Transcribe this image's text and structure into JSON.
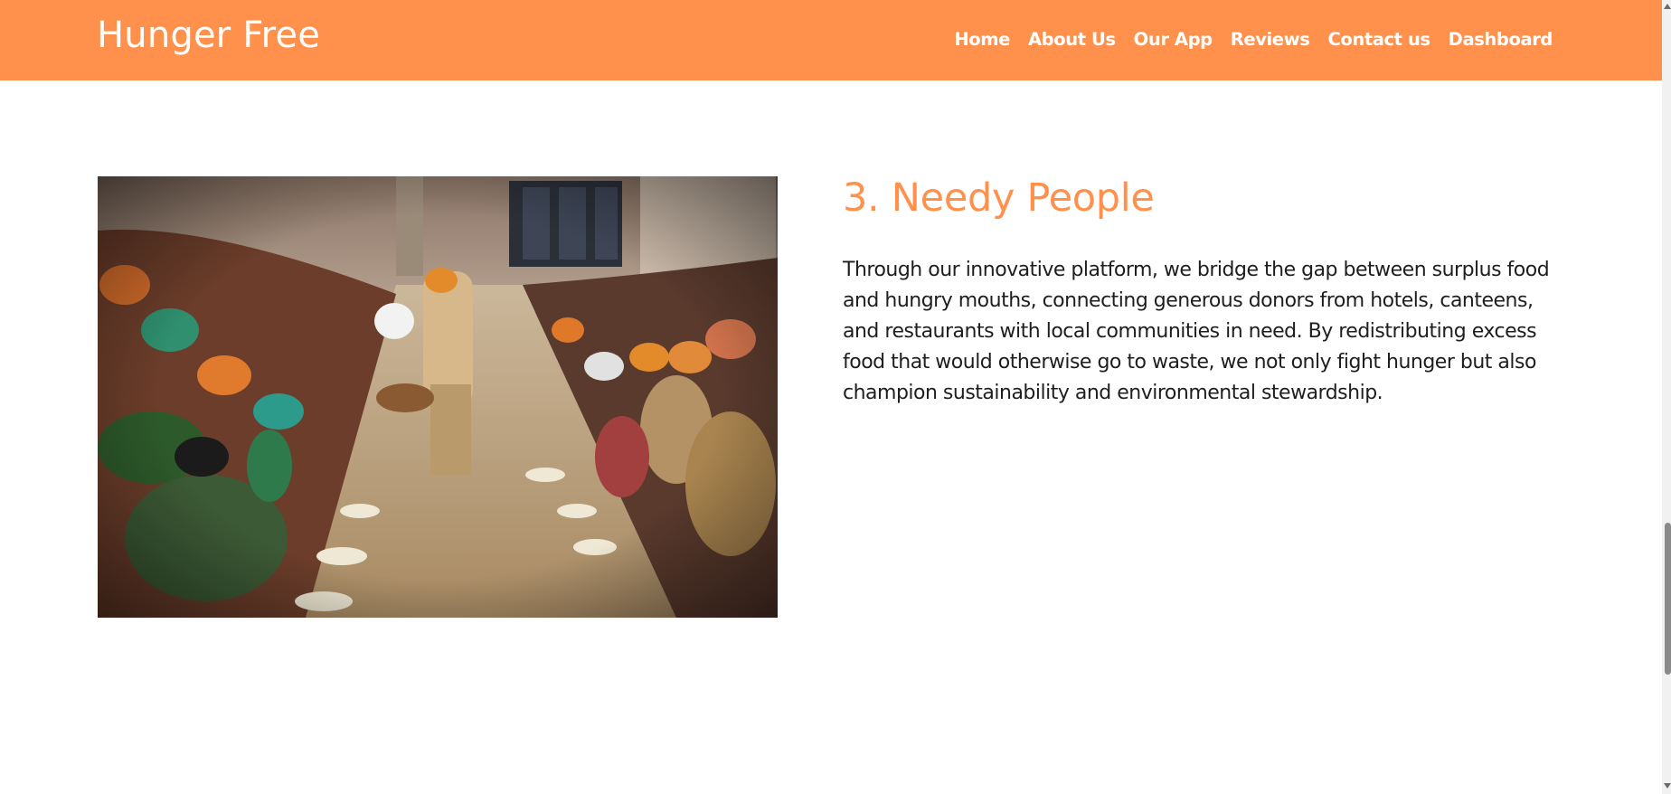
{
  "brand": {
    "name": "Hunger Free"
  },
  "nav": {
    "items": [
      {
        "label": "Home"
      },
      {
        "label": "About Us"
      },
      {
        "label": "Our App"
      },
      {
        "label": "Reviews"
      },
      {
        "label": "Contact us"
      },
      {
        "label": "Dashboard"
      }
    ]
  },
  "section": {
    "title": "3. Needy People",
    "body": "Through our innovative platform, we bridge the gap between surplus food and hungry mouths, connecting generous donors from hotels, canteens, and restaurants with local communities in need. By redistributing excess food that would otherwise go to waste, we not only fight hunger but also champion sustainability and environmental stewardship."
  },
  "colors": {
    "accent": "#ff914d",
    "nav_text": "#ffffff",
    "body_text": "#1e1e1e"
  }
}
